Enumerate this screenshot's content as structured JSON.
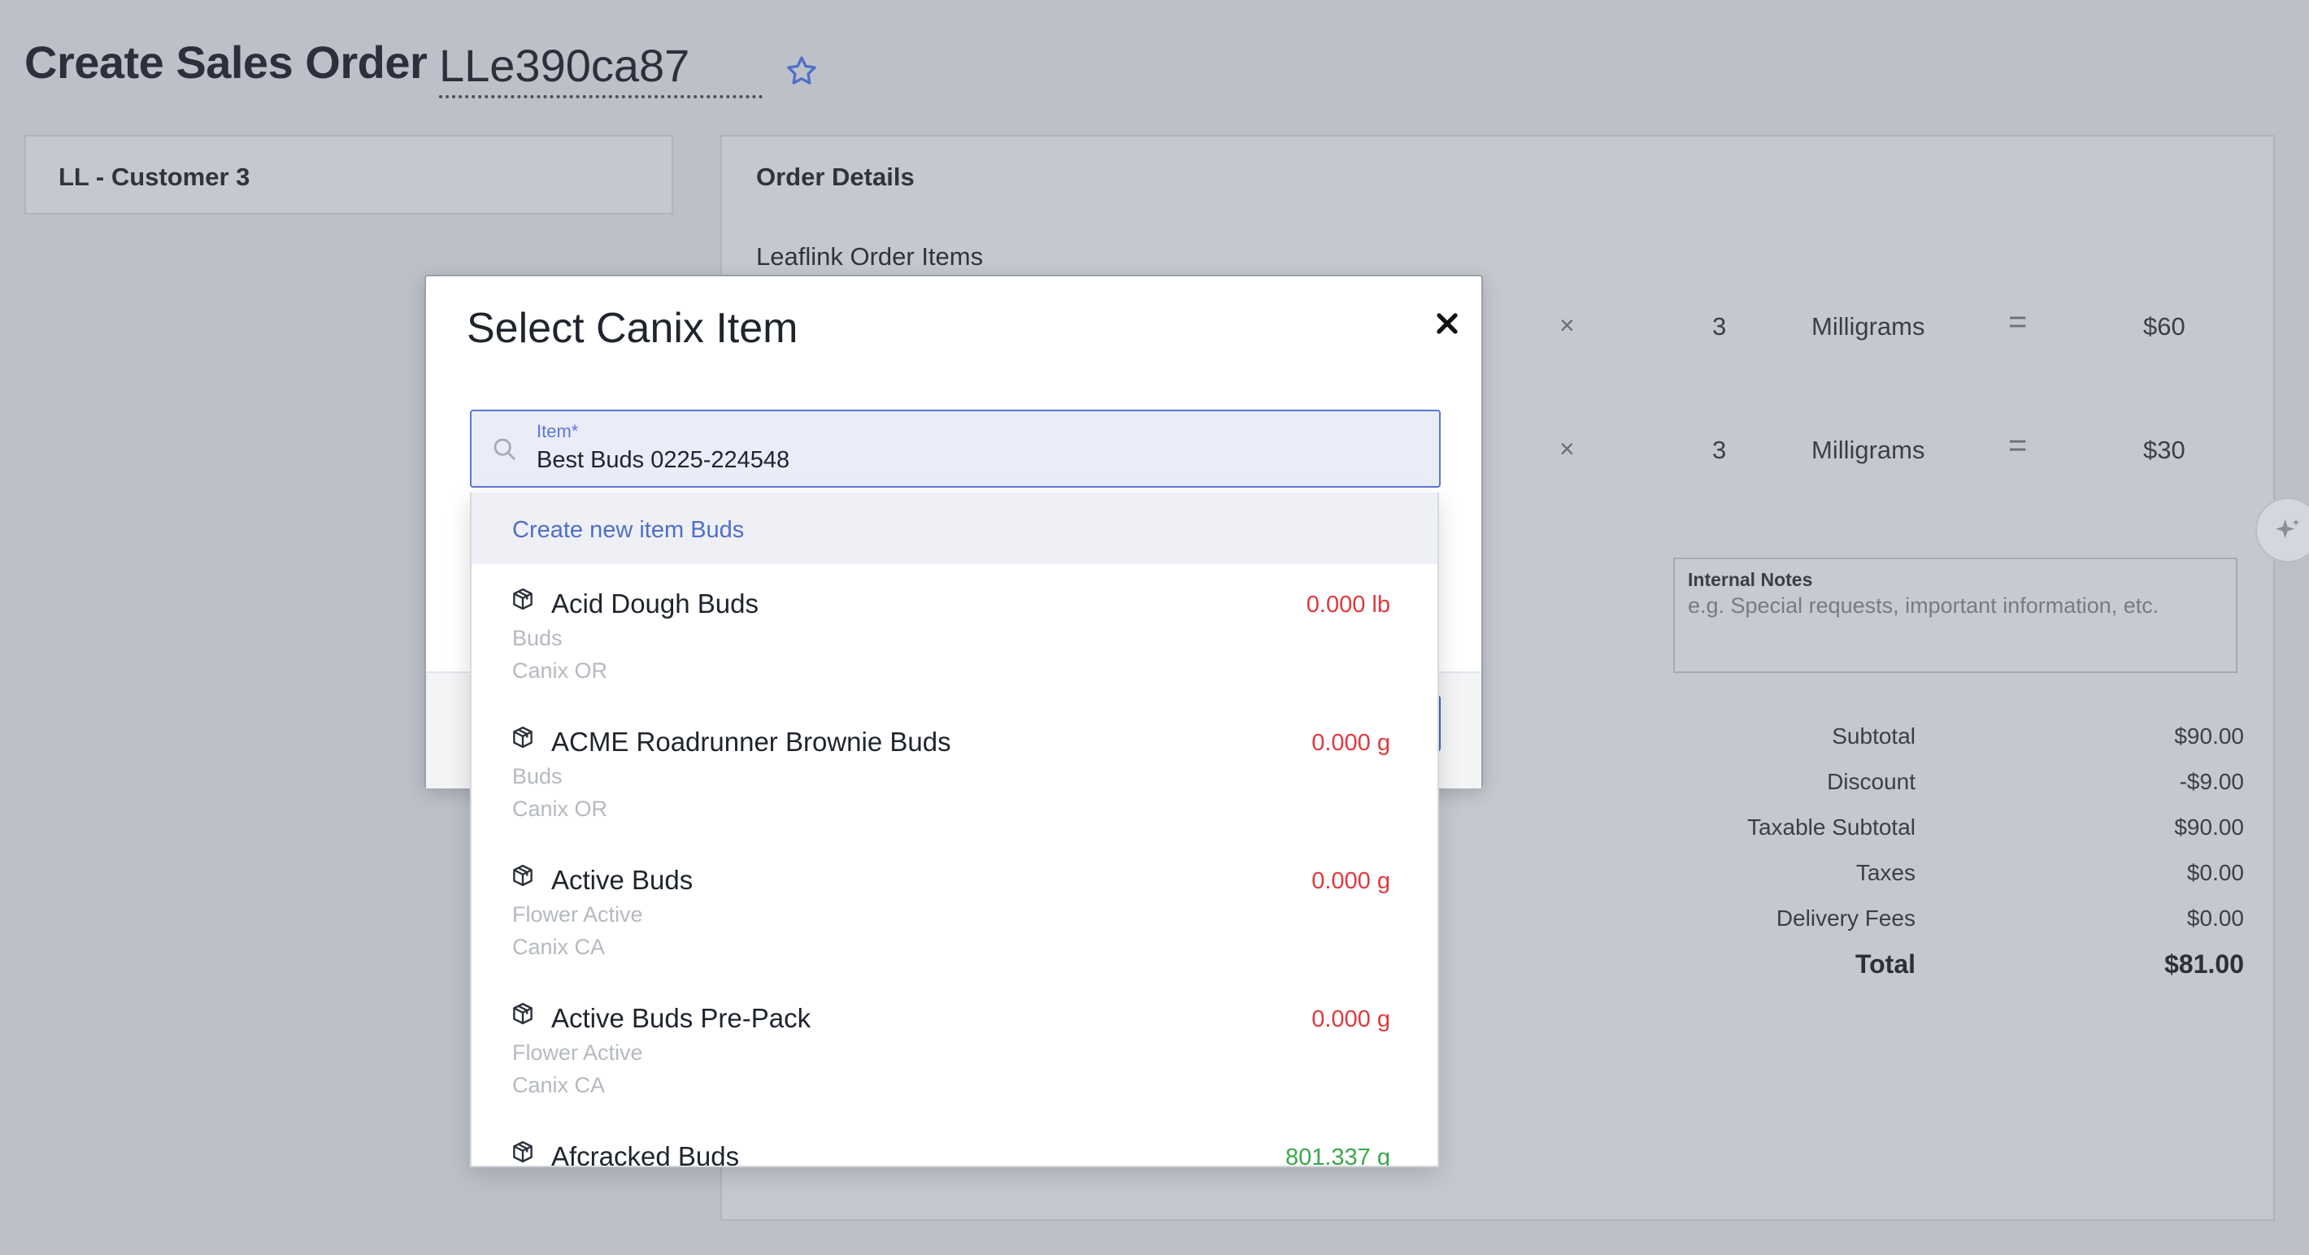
{
  "header": {
    "title": "Create Sales Order",
    "order_number": "LLe390ca87"
  },
  "customer": {
    "name": "LL - Customer 3"
  },
  "order": {
    "title": "Order Details",
    "items_title": "Leaflink Order Items",
    "lines": [
      {
        "times": "×",
        "qty": "3",
        "unit": "Milligrams",
        "equals": "=",
        "amount": "$60"
      },
      {
        "times": "×",
        "qty": "3",
        "unit": "Milligrams",
        "equals": "=",
        "amount": "$30"
      }
    ],
    "notes": {
      "label": "Internal Notes",
      "placeholder": "e.g. Special requests, important information, etc."
    },
    "summary": {
      "subtotal_label": "Subtotal",
      "subtotal": "$90.00",
      "discount_label": "Discount",
      "discount": "-$9.00",
      "taxable_label": "Taxable Subtotal",
      "taxable": "$90.00",
      "taxes_label": "Taxes",
      "taxes": "$0.00",
      "delivery_label": "Delivery Fees",
      "delivery": "$0.00",
      "total_label": "Total",
      "total": "$81.00"
    }
  },
  "modal": {
    "title": "Select Canix Item",
    "close_icon": "×",
    "item_field": {
      "label": "Item*",
      "value": "Best Buds 0225-224548"
    }
  },
  "dropdown": {
    "create_label": "Create new item Buds",
    "options": [
      {
        "name": "Acid Dough Buds",
        "category": "Buds",
        "location": "Canix OR",
        "quantity": "0.000 lb",
        "qty_color": "#e0393e"
      },
      {
        "name": "ACME Roadrunner Brownie Buds",
        "category": "Buds",
        "location": "Canix OR",
        "quantity": "0.000 g",
        "qty_color": "#e0393e"
      },
      {
        "name": "Active Buds",
        "category": "Flower Active",
        "location": "Canix CA",
        "quantity": "0.000 g",
        "qty_color": "#e0393e"
      },
      {
        "name": "Active Buds Pre-Pack",
        "category": "Flower Active",
        "location": "Canix CA",
        "quantity": "0.000 g",
        "qty_color": "#e0393e"
      },
      {
        "name": "Afcracked Buds",
        "category": "",
        "location": "",
        "quantity": "801.337 g",
        "qty_color": "#3aa84c"
      }
    ]
  },
  "colors": {
    "accent": "#5a78d6",
    "negative": "#e0393e",
    "positive": "#3aa84c",
    "overlay": "#bcc1c9"
  },
  "icons": {
    "favorite": "star-icon",
    "search": "search-icon",
    "item": "box-icon",
    "close": "close-icon",
    "assistant": "sparkle-icon"
  }
}
